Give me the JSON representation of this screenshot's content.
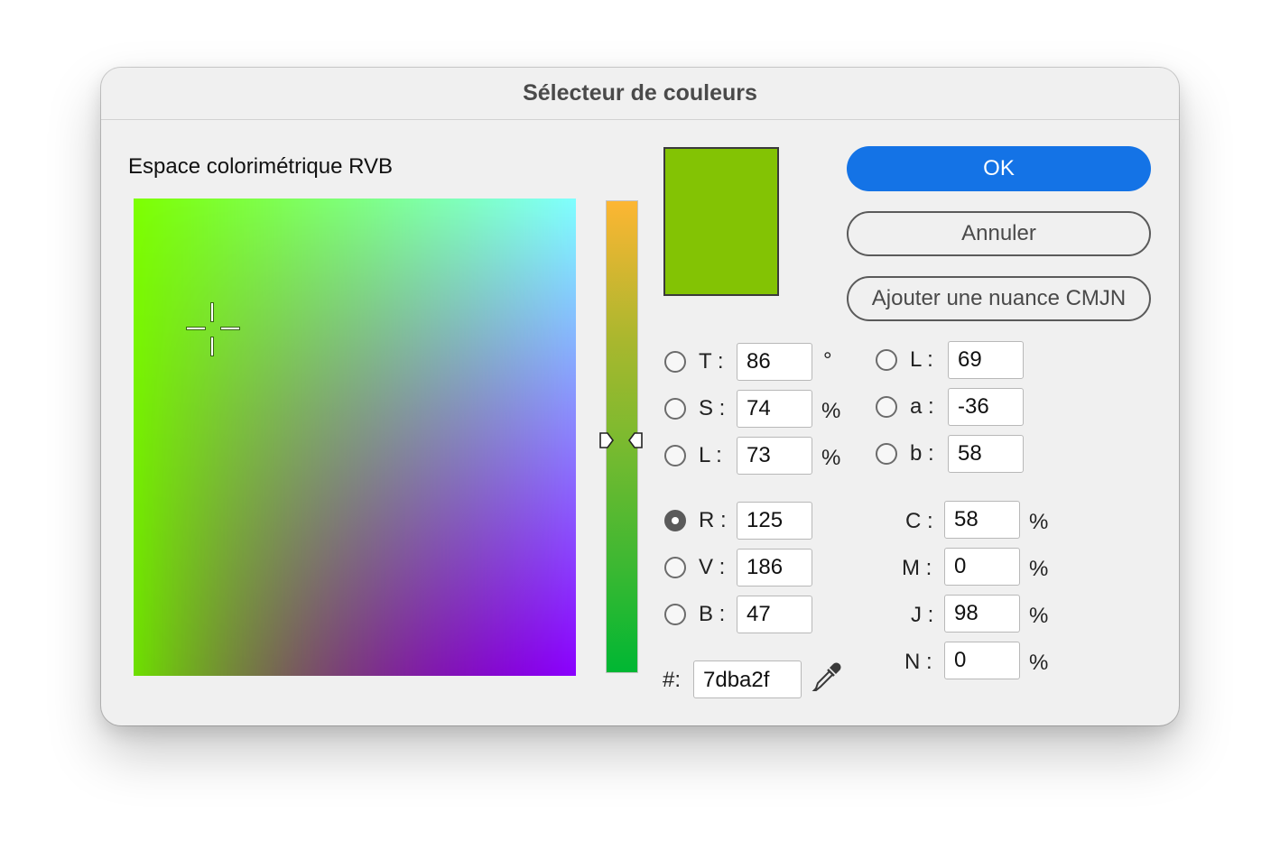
{
  "window": {
    "title": "Sélecteur de couleurs"
  },
  "picker": {
    "color_space_label": "Espace colorimétrique RVB",
    "current_color": "#7dba2f"
  },
  "buttons": {
    "ok": "OK",
    "cancel": "Annuler",
    "add_cmyk": "Ajouter une nuance CMJN"
  },
  "hsl": {
    "h": {
      "label": "T :",
      "value": "86",
      "unit": "°"
    },
    "s": {
      "label": "S :",
      "value": "74",
      "unit": "%"
    },
    "l": {
      "label": "L :",
      "value": "73",
      "unit": "%"
    }
  },
  "rgb": {
    "r": {
      "label": "R :",
      "value": "125"
    },
    "g": {
      "label": "V :",
      "value": "186"
    },
    "b": {
      "label": "B :",
      "value": "47"
    }
  },
  "lab": {
    "l": {
      "label": "L :",
      "value": "69"
    },
    "a": {
      "label": "a :",
      "value": "-36"
    },
    "b": {
      "label": "b :",
      "value": "58"
    }
  },
  "cmyk": {
    "c": {
      "label": "C :",
      "value": "58",
      "unit": "%"
    },
    "m": {
      "label": "M :",
      "value": "0",
      "unit": "%"
    },
    "y": {
      "label": "J :",
      "value": "98",
      "unit": "%"
    },
    "k": {
      "label": "N :",
      "value": "0",
      "unit": "%"
    }
  },
  "hex": {
    "label": "#:",
    "value": "7dba2f"
  },
  "selected_channel": "R"
}
